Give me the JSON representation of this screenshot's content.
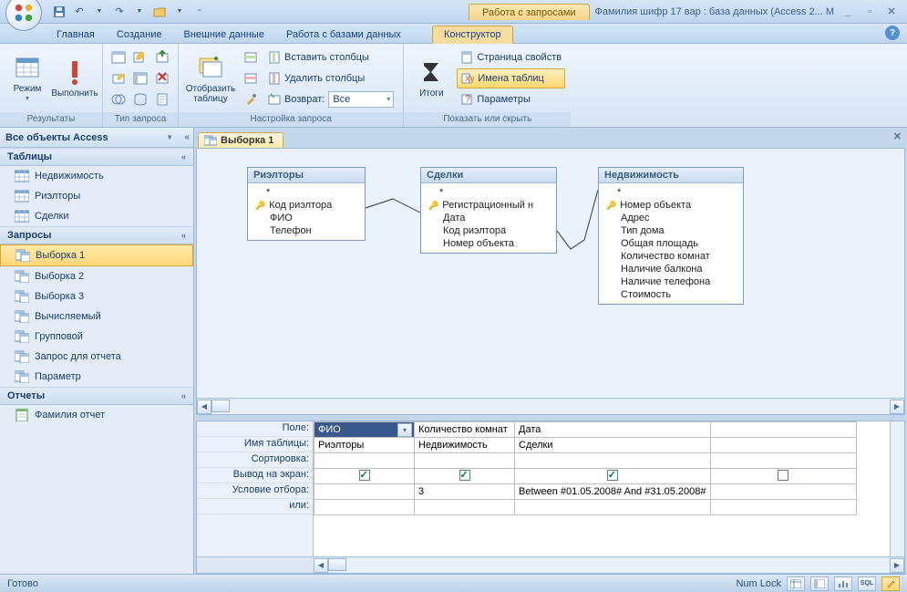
{
  "title": "Фамилия шифр 17 вар : база данных (Access 2... M",
  "context_tab_top": "Работа с запросами",
  "tabs": [
    "Главная",
    "Создание",
    "Внешние данные",
    "Работа с базами данных",
    "Конструктор"
  ],
  "active_tab": "Конструктор",
  "ribbon": {
    "results": {
      "label": "Результаты",
      "view": "Режим",
      "run": "Выполнить"
    },
    "qtype": {
      "label": "Тип запроса"
    },
    "setup": {
      "label": "Настройка запроса",
      "show_table": "Отобразить\nтаблицу",
      "insert_cols": "Вставить столбцы",
      "delete_cols": "Удалить столбцы",
      "return": "Возврат:",
      "return_val": "Все"
    },
    "showhide": {
      "label": "Показать или скрыть",
      "totals": "Итоги",
      "propsheet": "Страница свойств",
      "tablenames": "Имена таблиц",
      "params": "Параметры"
    }
  },
  "nav": {
    "header": "Все объекты Access",
    "sections": [
      {
        "title": "Таблицы",
        "items": [
          "Недвижимость",
          "Риэлторы",
          "Сделки"
        ],
        "type": "table"
      },
      {
        "title": "Запросы",
        "items": [
          "Выборка 1",
          "Выборка 2",
          "Выборка 3",
          "Вычисляемый",
          "Групповой",
          "Запрос для отчета",
          "Параметр"
        ],
        "type": "query",
        "selected": "Выборка 1"
      },
      {
        "title": "Отчеты",
        "items": [
          "Фамилия отчет"
        ],
        "type": "report"
      }
    ]
  },
  "doc_tab": "Выборка 1",
  "tables": {
    "t1": {
      "title": "Риэлторы",
      "star": "*",
      "fields": [
        "Код риэлтора",
        "ФИО",
        "Телефон"
      ],
      "key": 0
    },
    "t2": {
      "title": "Сделки",
      "star": "*",
      "fields": [
        "Регистрационный н",
        "Дата",
        "Код риэлтора",
        "Номер объекта"
      ],
      "key": 0
    },
    "t3": {
      "title": "Недвижимость",
      "star": "*",
      "fields": [
        "Номер объекта",
        "Адрес",
        "Тип дома",
        "Общая площадь",
        "Количество комнат",
        "Наличие балкона",
        "Наличие телефона",
        "Стоимость"
      ],
      "key": 0
    }
  },
  "qbe": {
    "labels": [
      "Поле:",
      "Имя таблицы:",
      "Сортировка:",
      "Вывод на экран:",
      "Условие отбора:",
      "или:"
    ],
    "cols": [
      {
        "field": "ФИО",
        "table": "Риэлторы",
        "show": true,
        "crit": "",
        "selected": true
      },
      {
        "field": "Количество комнат",
        "table": "Недвижимость",
        "show": true,
        "crit": "3"
      },
      {
        "field": "Дата",
        "table": "Сделки",
        "show": true,
        "crit": "Between #01.05.2008# And #31.05.2008#"
      },
      {
        "field": "",
        "table": "",
        "show": false,
        "crit": ""
      }
    ]
  },
  "status": "Готово",
  "numlock": "Num Lock"
}
